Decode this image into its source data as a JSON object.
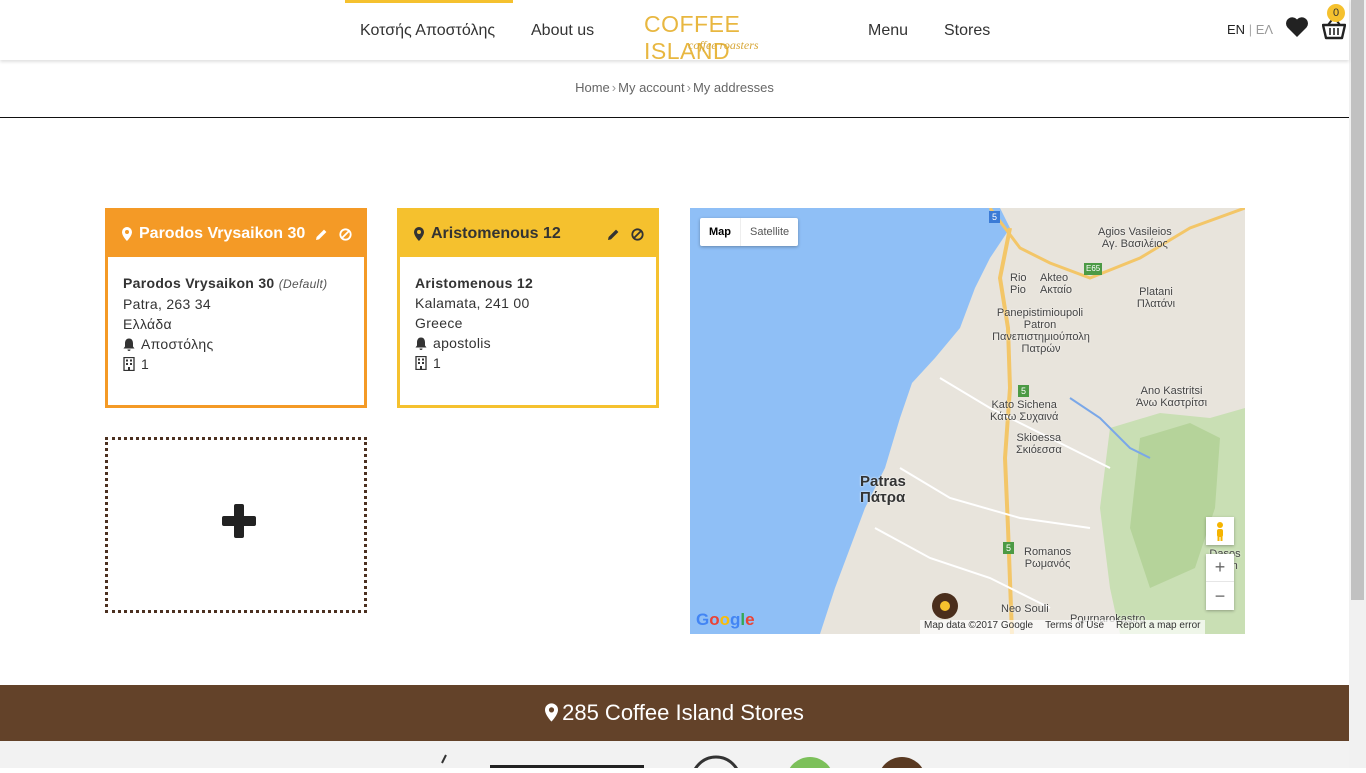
{
  "header": {
    "nav": [
      "Κοτσής Αποστόλης",
      "About us",
      "Menu",
      "Stores"
    ],
    "logo": {
      "top": "COFFEE ISLAND",
      "sub": "coffee roasters"
    },
    "lang": {
      "en": "EN",
      "sep": "|",
      "el": "ΕΛ"
    },
    "cart_count": "0",
    "accent": "#f5c12e"
  },
  "breadcrumb": {
    "home": "Home",
    "account": "My account",
    "addresses": "My addresses"
  },
  "addresses": [
    {
      "title": "Parodos Vrysaikon 30",
      "name": "Parodos Vrysaikon 30",
      "default_tag": "(Default)",
      "city_line": "Patra, 263 34",
      "country": "Ελλάδα",
      "bell": "Αποστόλης",
      "floor": "1",
      "color": "#f49a26"
    },
    {
      "title": "Aristomenous 12",
      "name": "Aristomenous 12",
      "default_tag": "",
      "city_line": "Kalamata, 241 00",
      "country": "Greece",
      "bell": "apostolis",
      "floor": "1",
      "color": "#f5c12e"
    }
  ],
  "map": {
    "tab_map": "Map",
    "tab_satellite": "Satellite",
    "labels": {
      "agios": "Agios Vasileios",
      "agios_el": "Αγ. Βασιλέιος",
      "rio": "Rio Pio",
      "akteo": "Akteo Ακταίο",
      "pan": "Panepistimioupoli Patron",
      "pan_el": "Πανεπιστημιούπολη Πατρών",
      "platani": "Platani Πλατάνι",
      "kato": "Kato Sichena",
      "kato_el": "Κάτω Συχαινά",
      "ano": "Ano Kastritsi",
      "ano_el": "Άνω Καστρίτσι",
      "skio": "Skioessa",
      "skio_el": "Σκιόεσσα",
      "patras": "Patras",
      "patras_el": "Πάτρα",
      "romanos": "Romanos",
      "romanos_el": "Ρωμανός",
      "neo": "Neo Souli",
      "pournaro": "Pournarokastro",
      "dasos": "Dasos Chim",
      "road5a": "5",
      "road5b": "5",
      "road5c": "5",
      "e65": "E65"
    },
    "google": "Google",
    "map_data": "Map data ©2017 Google",
    "terms": "Terms of Use",
    "report": "Report a map error"
  },
  "footer": {
    "stores": "285 Coffee Island Stores"
  }
}
